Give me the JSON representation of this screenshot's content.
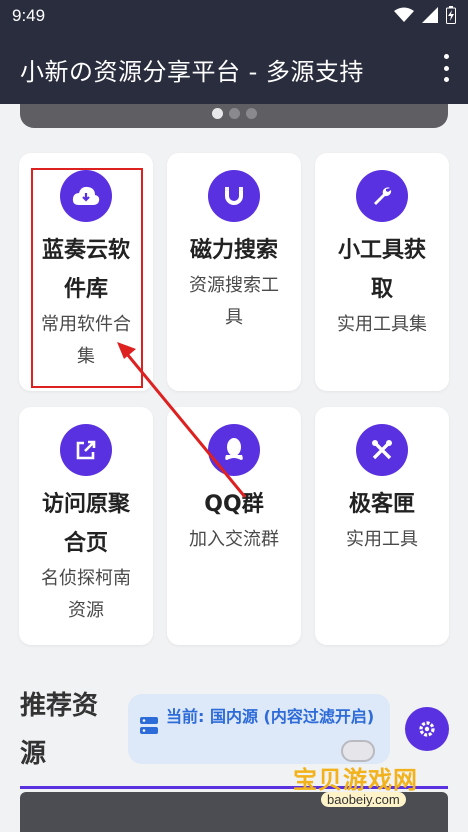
{
  "status_bar": {
    "time": "9:49"
  },
  "app_bar": {
    "title": "小新の资源分享平台 - 多源支持",
    "menu_icon": "more-vert-icon"
  },
  "banner": {
    "page_count": 3,
    "active_page": 1
  },
  "cards": [
    {
      "title": "蓝奏云软件库",
      "subtitle": "常用软件合集",
      "icon": "cloud-download-icon"
    },
    {
      "title": "磁力搜索",
      "subtitle": "资源搜索工具",
      "icon": "magnet-icon"
    },
    {
      "title": "小工具获取",
      "subtitle": "实用工具集",
      "icon": "wrench-icon"
    },
    {
      "title": "访问原聚合页",
      "subtitle": "名侦探柯南资源",
      "icon": "external-link-icon"
    },
    {
      "title": "QQ群",
      "subtitle": "加入交流群",
      "icon": "qq-icon"
    },
    {
      "title": "极客匣",
      "subtitle": "实用工具",
      "icon": "tools-icon"
    }
  ],
  "recommend": {
    "title": "推荐资源",
    "source_label": "当前: 国内源 (内容过滤开启)",
    "settings_icon": "gear-icon"
  },
  "watermark": {
    "text": "宝贝游戏网",
    "url": "baobeiy.com"
  },
  "colors": {
    "appbar": "#292d3e",
    "accent": "#5a31e0",
    "pill_bg": "#dde8f8",
    "pill_text": "#2d6bd8",
    "annotation": "#dd2020"
  }
}
